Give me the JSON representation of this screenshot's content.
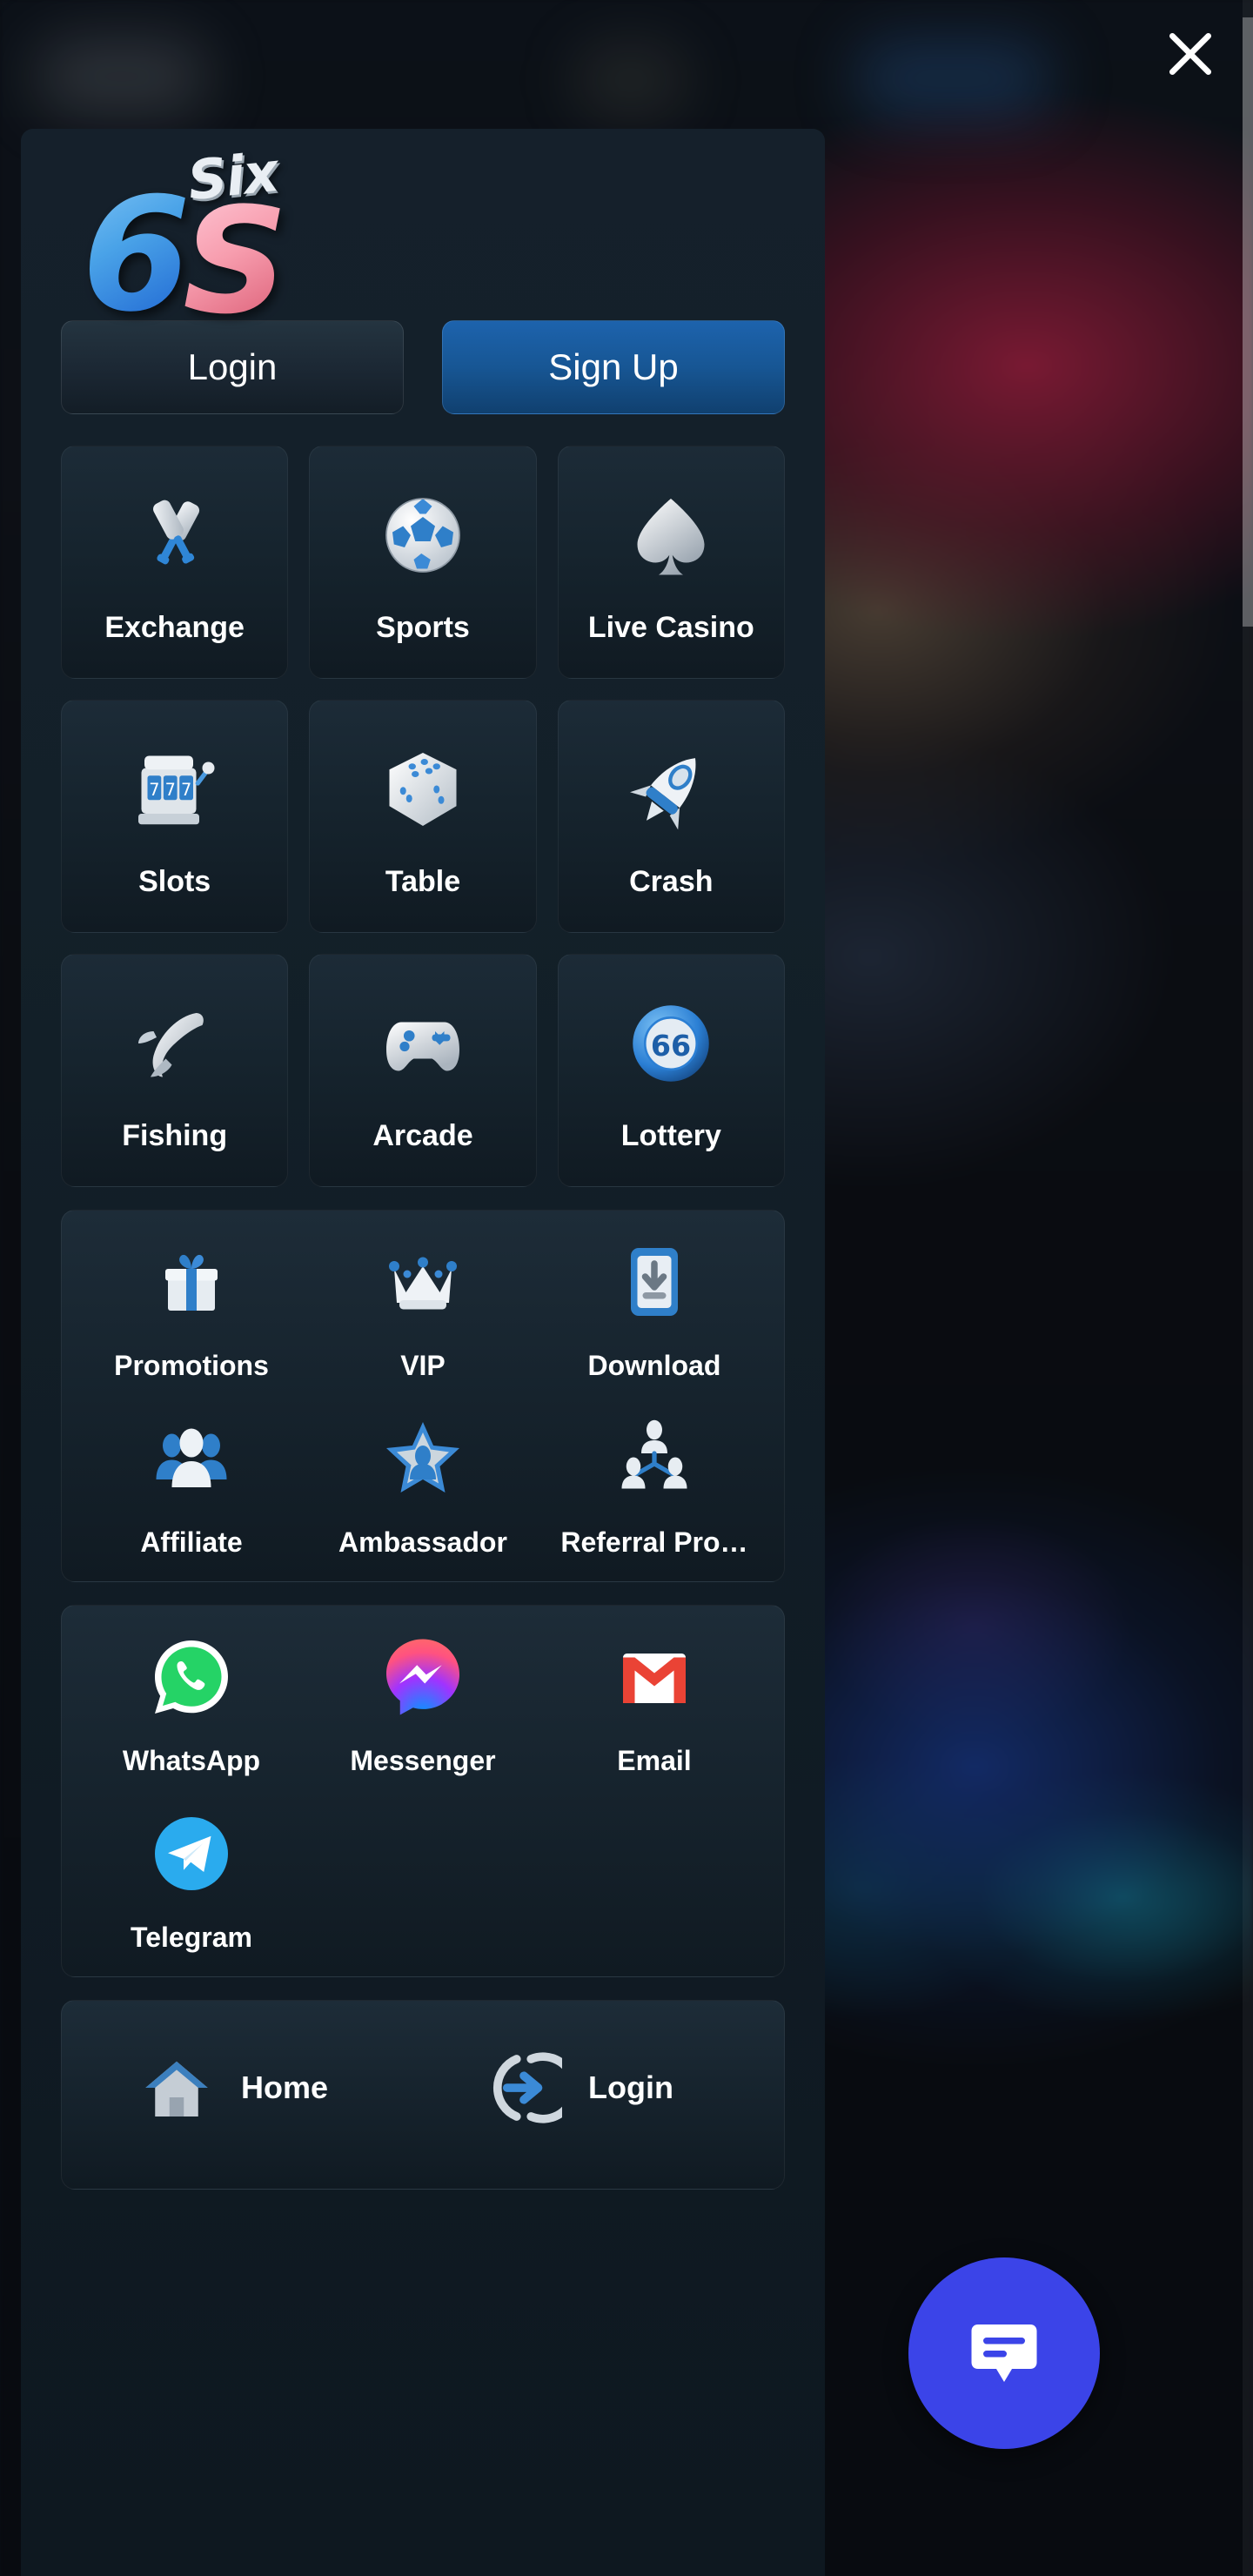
{
  "overlay": {
    "close_icon": "close-icon"
  },
  "brand": {
    "mark_six": "Six",
    "mark_6": "6",
    "mark_s": "S"
  },
  "auth": {
    "login_label": "Login",
    "signup_label": "Sign Up"
  },
  "categories": [
    [
      {
        "label": "Exchange",
        "icon": "cricket-bats-icon"
      },
      {
        "label": "Sports",
        "icon": "soccer-ball-icon"
      },
      {
        "label": "Live Casino",
        "icon": "spade-icon"
      }
    ],
    [
      {
        "label": "Slots",
        "icon": "slot-machine-icon"
      },
      {
        "label": "Table",
        "icon": "dice-icon"
      },
      {
        "label": "Crash",
        "icon": "rocket-icon"
      }
    ],
    [
      {
        "label": "Fishing",
        "icon": "fish-icon"
      },
      {
        "label": "Arcade",
        "icon": "gamepad-icon"
      },
      {
        "label": "Lottery",
        "icon": "lottery-ball-icon"
      }
    ]
  ],
  "promo_panel": [
    [
      {
        "label": "Promotions",
        "icon": "gift-icon"
      },
      {
        "label": "VIP",
        "icon": "crown-icon"
      },
      {
        "label": "Download",
        "icon": "download-phone-icon"
      }
    ],
    [
      {
        "label": "Affiliate",
        "icon": "people-group-icon"
      },
      {
        "label": "Ambassador",
        "icon": "star-person-icon"
      },
      {
        "label": "Referral Pro…",
        "icon": "referral-tree-icon"
      }
    ]
  ],
  "social_panel": [
    [
      {
        "label": "WhatsApp",
        "icon": "whatsapp-icon"
      },
      {
        "label": "Messenger",
        "icon": "messenger-icon"
      },
      {
        "label": "Email",
        "icon": "gmail-icon"
      }
    ],
    [
      {
        "label": "Telegram",
        "icon": "telegram-icon"
      }
    ]
  ],
  "bottom_nav": [
    {
      "label": "Home",
      "icon": "house-icon"
    },
    {
      "label": "Login",
      "icon": "login-arrow-icon"
    }
  ],
  "chat": {
    "icon": "chat-bubble-icon"
  },
  "colors": {
    "drawer_bg": "#15202b",
    "tile_bg": "#1c2b37",
    "signup_accent": "#1d63ad",
    "chat_fab": "#3b44e8",
    "whatsapp_green": "#25d366",
    "telegram_blue": "#2aabee",
    "gmail_red": "#ea4335",
    "lottery_blue": "#2b7fd4"
  }
}
